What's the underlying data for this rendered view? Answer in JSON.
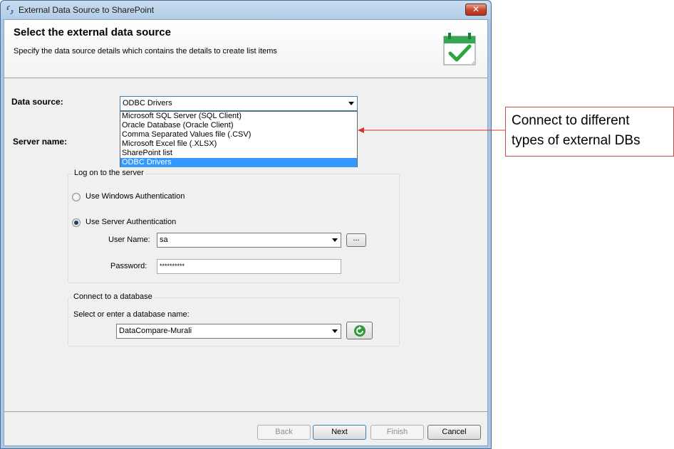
{
  "window": {
    "title": "External Data Source to SharePoint",
    "close_label": "✕"
  },
  "header": {
    "title": "Select the external data source",
    "subtitle": "Specify the data source details which contains the details to create list items"
  },
  "form": {
    "data_source_label": "Data source:",
    "data_source_value": "ODBC Drivers",
    "data_source_options": [
      "Microsoft SQL Server (SQL Client)",
      "Oracle Database (Oracle Client)",
      "Comma Separated Values file (.CSV)",
      "Microsoft Excel file (.XLSX)",
      "SharePoint list",
      "ODBC Drivers"
    ],
    "server_name_label": "Server name:",
    "logon_group_title": "Log on to the server",
    "windows_auth_label": "Use Windows Authentication",
    "server_auth_label": "Use Server Authentication",
    "username_label": "User Name:",
    "username_value": "sa",
    "browse_label": "...",
    "password_label": "Password:",
    "password_value": "**********",
    "database_group_title": "Connect to a database",
    "database_prompt": "Select or enter a database name:",
    "database_value": "DataCompare-Murali"
  },
  "footer": {
    "back_label": "Back",
    "next_label": "Next",
    "finish_label": "Finish",
    "cancel_label": "Cancel"
  },
  "annotation": {
    "line1": "Connect to different",
    "line2": "types of external DBs"
  }
}
